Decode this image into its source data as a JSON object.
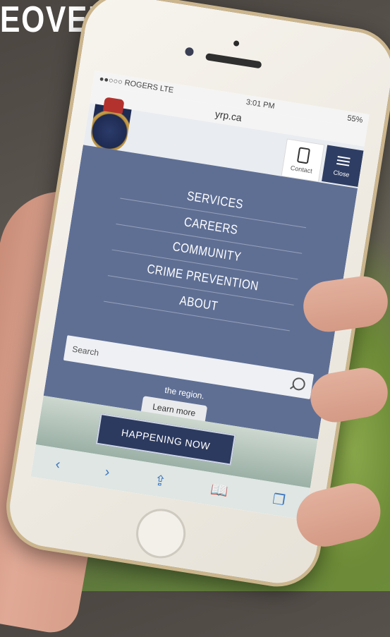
{
  "headline": "EOVER",
  "status_bar": {
    "carrier": "●●○○○ ROGERS  LTE",
    "time": "3:01 PM",
    "battery": "55%"
  },
  "browser": {
    "url": "yrp.ca",
    "reload_icon": "reload-icon"
  },
  "header": {
    "contact_label": "Contact",
    "close_label": "Close"
  },
  "menu": {
    "items": [
      "SERVICES",
      "CAREERS",
      "COMMUNITY",
      "CRIME PREVENTION",
      "ABOUT"
    ],
    "search_placeholder": "Search"
  },
  "hero": {
    "text": "the region.",
    "learn_more": "Learn more",
    "happening_now": "HAPPENING NOW"
  },
  "toolbar": {
    "back": "‹",
    "forward": "›",
    "share": "⇪",
    "bookmarks": "📖",
    "tabs": "❐"
  },
  "colors": {
    "menu_bg": "#5f6f94",
    "close_bg": "#2e3d63",
    "ios_blue": "#3a76c2"
  }
}
